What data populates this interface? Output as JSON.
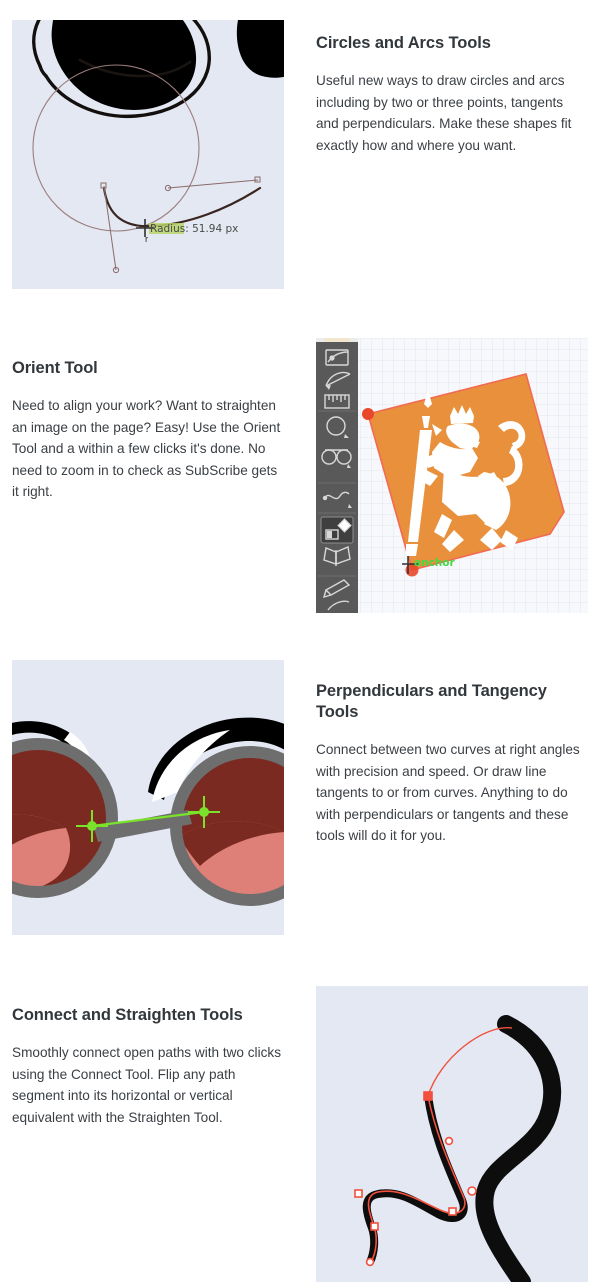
{
  "page": {
    "background": "#ffffff",
    "media_background": "#e3e8f3",
    "heading_color": "#32373c",
    "body_color": "#3a3f44"
  },
  "features": [
    {
      "id": "circles-and-arcs",
      "heading": "Circles and Arcs Tools",
      "body": "Useful new ways to draw circles and arcs including by two or three points, tangents and perpendiculars. Make these shapes fit exactly how and where you want.",
      "media": {
        "alt": "Vector canvas showing circle construction over black brush strokes",
        "layout": "image-left",
        "annotation_label": "Radius: 51.94 px",
        "annotation_text_color": "#4d4d4d",
        "annotation_highlight_color": "#b9d46a",
        "guide_color": "#8a6a6a",
        "ink_color": "#1a1410",
        "cursor": "crosshair-r"
      }
    },
    {
      "id": "orient-tool",
      "heading": "Orient Tool",
      "body": "Need to align your work? Want to straighten an image on the page? Easy! Use the Orient Tool and a within a few clicks it's done. No need to zoom in to check as SubScribe gets it right.",
      "media": {
        "alt": "Illustrator toolbar beside a rotated orange artboard with a white heraldic lion",
        "layout": "image-right",
        "annotation_label": "anchor",
        "annotation_text_color": "#45d845",
        "toolbar_background": "#595959",
        "toolbar_icon_color": "#d8d8d8",
        "toolbar_active_background": "#3f3f3f",
        "canvas_background": "#f7f8fb",
        "grid_color": "#dde1ec",
        "shape_fill": "#e8903c",
        "shape_stroke": "#f0604d",
        "anchor_color": "#e8472c",
        "emblem_color": "#ffffff",
        "toolbar_icons": [
          "artboard-icon",
          "arc-icon",
          "ruler-icon",
          "circle-tool-icon",
          "tangency-icon",
          "curve-icon",
          "orient-tool-icon",
          "butterfly-icon",
          "pen-icon",
          "feather-icon",
          "crop-icon"
        ]
      }
    },
    {
      "id": "perpendiculars-and-tangency",
      "heading": "Perpendiculars and Tangency Tools",
      "body": "Connect between two curves at right angles with precision and speed. Or draw line tangents to or from curves. Anything to do with perpendiculars or tangents and these tools will do it for you.",
      "media": {
        "alt": "Cartoon spectacles with a green perpendicular construction line between two lens frames",
        "layout": "image-left",
        "frame_color": "#6e6e6e",
        "lens_top_color": "#7a2a20",
        "lens_bottom_color": "#de8078",
        "brow_color": "#000000",
        "highlight_color": "#ffffff",
        "construction_color": "#7ae22a"
      }
    },
    {
      "id": "connect-and-straighten",
      "heading": "Connect and Straighten Tools",
      "body": "Smoothly connect open paths with two clicks using the Connect Tool. Flip any path segment into its horizontal or vertical equivalent with the Straighten Tool.",
      "media": {
        "alt": "Black calligraphic stroke with a selected red bezier path and anchor points",
        "layout": "image-right",
        "ink_color": "#0d0d0d",
        "path_color": "#f2503c",
        "anchor_fill": "#ffffff",
        "anchor_stroke": "#f2503c"
      }
    }
  ]
}
